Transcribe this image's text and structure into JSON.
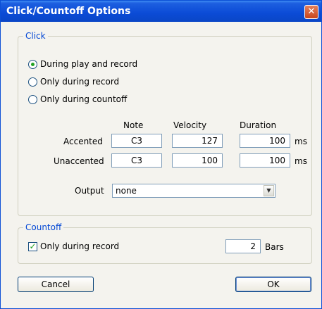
{
  "window": {
    "title": "Click/Countoff Options",
    "close_glyph": "✕"
  },
  "click_group": {
    "legend": "Click",
    "options": [
      {
        "label": "During play and record",
        "selected": true
      },
      {
        "label": "Only during record",
        "selected": false
      },
      {
        "label": "Only during countoff",
        "selected": false
      }
    ],
    "headers": {
      "note": "Note",
      "velocity": "Velocity",
      "duration": "Duration"
    },
    "rows": [
      {
        "label": "Accented",
        "note": "C3",
        "velocity": "127",
        "duration": "100",
        "unit": "ms"
      },
      {
        "label": "Unaccented",
        "note": "C3",
        "velocity": "100",
        "duration": "100",
        "unit": "ms"
      }
    ],
    "output": {
      "label": "Output",
      "value": "none"
    }
  },
  "countoff_group": {
    "legend": "Countoff",
    "only_record": {
      "label": "Only during record",
      "checked": true
    },
    "bars": {
      "value": "2",
      "unit": "Bars"
    }
  },
  "buttons": {
    "cancel": "Cancel",
    "ok": "OK"
  }
}
